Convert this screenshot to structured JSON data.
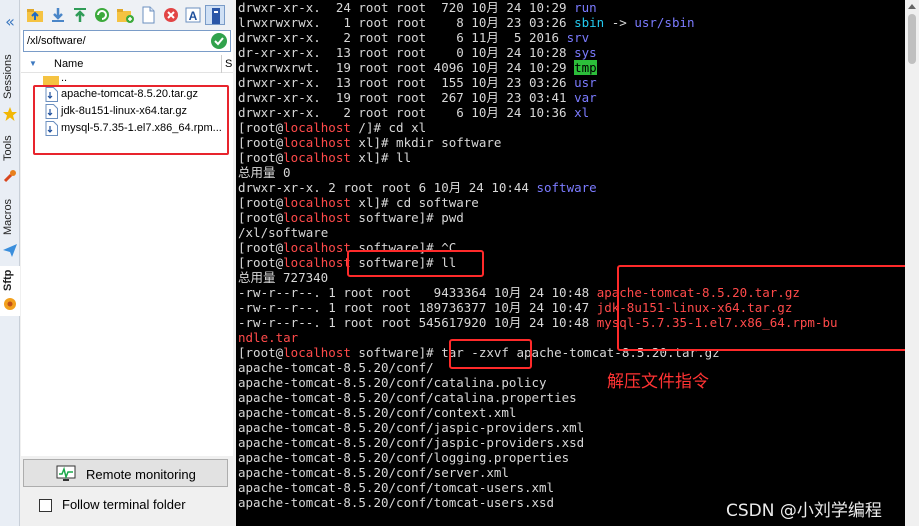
{
  "sidebar_tabs": [
    {
      "label": "Sessions",
      "icon": "star-icon"
    },
    {
      "label": "Tools",
      "icon": "wrench-icon"
    },
    {
      "label": "Macros",
      "icon": "paper-plane-icon"
    },
    {
      "label": "Sftp",
      "icon": "sftp-icon"
    }
  ],
  "toolbar": {
    "buttons": [
      "parent-dir-icon",
      "download-icon",
      "upload-icon",
      "refresh-icon",
      "new-folder-icon",
      "new-file-icon",
      "delete-icon",
      "rename-icon",
      "terminal-icon"
    ]
  },
  "path_bar": {
    "value": "/xl/software/"
  },
  "file_list": {
    "column_header": "Name",
    "column_s": "S",
    "parent": "..",
    "files": [
      "apache-tomcat-8.5.20.tar.gz",
      "jdk-8u151-linux-x64.tar.gz",
      "mysql-5.7.35-1.el7.x86_64.rpm..."
    ]
  },
  "bottom": {
    "remote_monitoring": "Remote monitoring",
    "follow_terminal": "Follow terminal folder"
  },
  "terminal": {
    "prompt_user": "root",
    "prompt_host": "localhost",
    "lines": [
      [
        {
          "t": "drwxr-xr-x.  24 root root  720 10月 24 10:29 "
        },
        {
          "t": "run",
          "c": "blue"
        }
      ],
      [
        {
          "t": "lrwxrwxrwx.   1 root root    8 10月 23 03:26 "
        },
        {
          "t": "sbin",
          "c": "cyan"
        },
        {
          "t": " -> "
        },
        {
          "t": "usr/sbin",
          "c": "blue"
        }
      ],
      [
        {
          "t": "drwxr-xr-x.   2 root root    6 11月  5 2016 "
        },
        {
          "t": "srv",
          "c": "blue"
        }
      ],
      [
        {
          "t": "dr-xr-xr-x.  13 root root    0 10月 24 10:28 "
        },
        {
          "t": "sys",
          "c": "blue"
        }
      ],
      [
        {
          "t": "drwxrwxrwt.  19 root root 4096 10月 24 10:29 "
        },
        {
          "t": "tmp",
          "c": "tmp"
        }
      ],
      [
        {
          "t": "drwxr-xr-x.  13 root root  155 10月 23 03:26 "
        },
        {
          "t": "usr",
          "c": "blue"
        }
      ],
      [
        {
          "t": "drwxr-xr-x.  19 root root  267 10月 23 03:41 "
        },
        {
          "t": "var",
          "c": "blue"
        }
      ],
      [
        {
          "t": "drwxr-xr-x.   2 root root    6 10月 24 10:36 "
        },
        {
          "t": "xl",
          "c": "blue"
        }
      ],
      [
        {
          "t": "[root@"
        },
        {
          "t": "localhost",
          "c": "red"
        },
        {
          "t": " /]# cd xl"
        }
      ],
      [
        {
          "t": "[root@"
        },
        {
          "t": "localhost",
          "c": "red"
        },
        {
          "t": " xl]# mkdir software"
        }
      ],
      [
        {
          "t": "[root@"
        },
        {
          "t": "localhost",
          "c": "red"
        },
        {
          "t": " xl]# ll"
        }
      ],
      [
        {
          "t": "总用量 0"
        }
      ],
      [
        {
          "t": "drwxr-xr-x. 2 root root 6 10月 24 10:44 "
        },
        {
          "t": "software",
          "c": "blue"
        }
      ],
      [
        {
          "t": "[root@"
        },
        {
          "t": "localhost",
          "c": "red"
        },
        {
          "t": " xl]# cd software"
        }
      ],
      [
        {
          "t": "[root@"
        },
        {
          "t": "localhost",
          "c": "red"
        },
        {
          "t": " software]# pwd"
        }
      ],
      [
        {
          "t": "/xl/software"
        }
      ],
      [
        {
          "t": "[root@"
        },
        {
          "t": "localhost",
          "c": "red"
        },
        {
          "t": " software]# ^C"
        }
      ],
      [
        {
          "t": "[root@"
        },
        {
          "t": "localhost",
          "c": "red"
        },
        {
          "t": " software]# ll"
        }
      ],
      [
        {
          "t": "总用量 727340"
        }
      ],
      [
        {
          "t": "-rw-r--r--. 1 root root   9433364 10月 24 10:48 "
        },
        {
          "t": "apache-tomcat-8.5.20.tar.gz",
          "c": "red"
        }
      ],
      [
        {
          "t": "-rw-r--r--. 1 root root 189736377 10月 24 10:47 "
        },
        {
          "t": "jdk-8u151-linux-x64.tar.gz",
          "c": "red"
        }
      ],
      [
        {
          "t": "-rw-r--r--. 1 root root 545617920 10月 24 10:48 "
        },
        {
          "t": "mysql-5.7.35-1.el7.x86_64.rpm-bu",
          "c": "red"
        }
      ],
      [
        {
          "t": "ndle.tar",
          "c": "red"
        }
      ],
      [
        {
          "t": "[root@"
        },
        {
          "t": "localhost",
          "c": "red"
        },
        {
          "t": " software]# tar -zxvf apache-tomcat-8.5.20.tar.gz"
        }
      ],
      [
        {
          "t": "apache-tomcat-8.5.20/conf/"
        }
      ],
      [
        {
          "t": "apache-tomcat-8.5.20/conf/catalina.policy"
        }
      ],
      [
        {
          "t": "apache-tomcat-8.5.20/conf/catalina.properties"
        }
      ],
      [
        {
          "t": "apache-tomcat-8.5.20/conf/context.xml"
        }
      ],
      [
        {
          "t": "apache-tomcat-8.5.20/conf/jaspic-providers.xml"
        }
      ],
      [
        {
          "t": "apache-tomcat-8.5.20/conf/jaspic-providers.xsd"
        }
      ],
      [
        {
          "t": "apache-tomcat-8.5.20/conf/logging.properties"
        }
      ],
      [
        {
          "t": "apache-tomcat-8.5.20/conf/server.xml"
        }
      ],
      [
        {
          "t": "apache-tomcat-8.5.20/conf/tomcat-users.xml"
        }
      ],
      [
        {
          "t": "apache-tomcat-8.5.20/conf/tomcat-users.xsd"
        }
      ]
    ]
  },
  "annotation": "解压文件指令",
  "watermark": "CSDN @小刘学编程",
  "colors": {
    "accent_red": "#e8242d",
    "term_blue": "#7b7bff",
    "term_cyan": "#23c9ef",
    "term_red": "#ff4a4a",
    "tmp_bg": "#2cbe3a"
  }
}
